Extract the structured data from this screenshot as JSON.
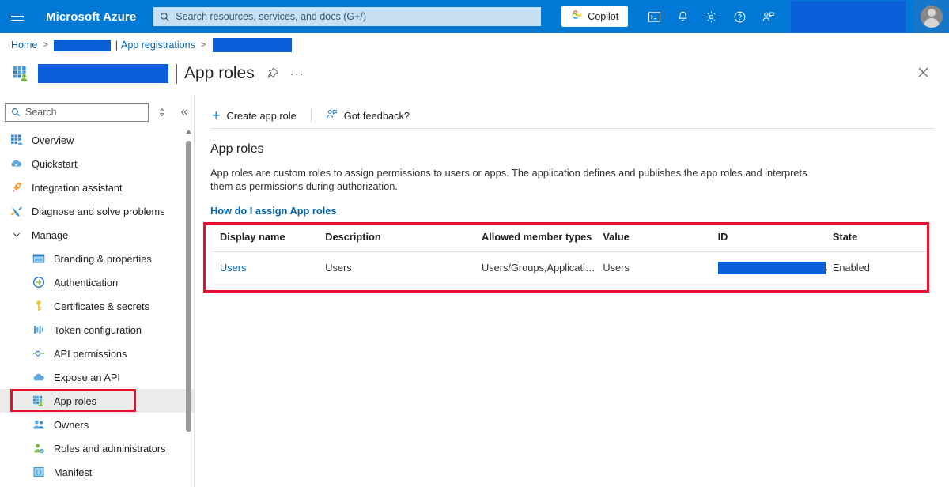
{
  "topbar": {
    "menu_icon": "hamburger-icon",
    "brand": "Microsoft Azure",
    "search_placeholder": "Search resources, services, and docs (G+/)",
    "search_value": "",
    "search_icon": "search-icon",
    "copilot_label": "Copilot",
    "copilot_icon": "copilot-icon",
    "icons": [
      {
        "name": "cloud-shell-icon",
        "glyph": "shell"
      },
      {
        "name": "notifications-bell-icon",
        "glyph": "bell"
      },
      {
        "name": "settings-gear-icon",
        "glyph": "gear"
      },
      {
        "name": "help-question-icon",
        "glyph": "help"
      },
      {
        "name": "feedback-person-icon",
        "glyph": "feedback"
      }
    ],
    "account_redacted": true,
    "avatar_name": "user-avatar"
  },
  "breadcrumb": {
    "home": "Home",
    "separator": ">",
    "tenant_redacted": true,
    "pipe": "|",
    "app_registrations": "App registrations",
    "app_redacted": true
  },
  "page": {
    "app_icon": "app-roles-icon",
    "app_name_redacted": true,
    "divider": "|",
    "title": "App roles",
    "pin_icon": "pin-icon",
    "more_icon": "ellipsis-icon",
    "close_icon": "close-icon"
  },
  "sidebar": {
    "search_placeholder": "Search",
    "search_value": "",
    "search_icon": "search-icon",
    "sort_icon": "sort-icon",
    "collapse_icon": "double-chevron-left-icon",
    "items": [
      {
        "label": "Overview",
        "icon": "overview-grid-icon",
        "indent": false,
        "selected": false
      },
      {
        "label": "Quickstart",
        "icon": "quickstart-cloud-icon",
        "indent": false,
        "selected": false
      },
      {
        "label": "Integration assistant",
        "icon": "rocket-icon",
        "indent": false,
        "selected": false
      },
      {
        "label": "Diagnose and solve problems",
        "icon": "wrench-tools-icon",
        "indent": false,
        "selected": false
      },
      {
        "label": "Manage",
        "icon": "chevron-down-icon",
        "indent": false,
        "selected": false,
        "group": true
      },
      {
        "label": "Branding & properties",
        "icon": "branding-window-icon",
        "indent": true,
        "selected": false
      },
      {
        "label": "Authentication",
        "icon": "authentication-arrow-icon",
        "indent": true,
        "selected": false
      },
      {
        "label": "Certificates & secrets",
        "icon": "key-icon",
        "indent": true,
        "selected": false
      },
      {
        "label": "Token configuration",
        "icon": "token-bars-icon",
        "indent": true,
        "selected": false
      },
      {
        "label": "API permissions",
        "icon": "api-permissions-icon",
        "indent": true,
        "selected": false
      },
      {
        "label": "Expose an API",
        "icon": "cloud-api-icon",
        "indent": true,
        "selected": false
      },
      {
        "label": "App roles",
        "icon": "app-roles-icon",
        "indent": true,
        "selected": true
      },
      {
        "label": "Owners",
        "icon": "owners-people-icon",
        "indent": true,
        "selected": false
      },
      {
        "label": "Roles and administrators",
        "icon": "roles-admin-icon",
        "indent": true,
        "selected": false
      },
      {
        "label": "Manifest",
        "icon": "manifest-braces-icon",
        "indent": true,
        "selected": false
      }
    ]
  },
  "command_bar": {
    "create_label": "Create app role",
    "create_icon": "plus-icon",
    "feedback_label": "Got feedback?",
    "feedback_icon": "feedback-person-icon"
  },
  "main": {
    "heading": "App roles",
    "description": "App roles are custom roles to assign permissions to users or apps. The application defines and publishes the app roles and interprets them as permissions during authorization.",
    "doc_link": "How do I assign App roles"
  },
  "table": {
    "columns": [
      "Display name",
      "Description",
      "Allowed member types",
      "Value",
      "ID",
      "State"
    ],
    "rows": [
      {
        "display_name": "Users",
        "description": "Users",
        "allowed_member_types": "Users/Groups,Applicatio...",
        "value": "Users",
        "id_redacted": true,
        "id_suffix": ".",
        "state": "Enabled"
      }
    ]
  },
  "annotations": {
    "highlight_color": "#e8112d",
    "redaction_color": "#0b5fd9",
    "boxes": [
      "sidebar-app-roles",
      "app-roles-table"
    ]
  }
}
